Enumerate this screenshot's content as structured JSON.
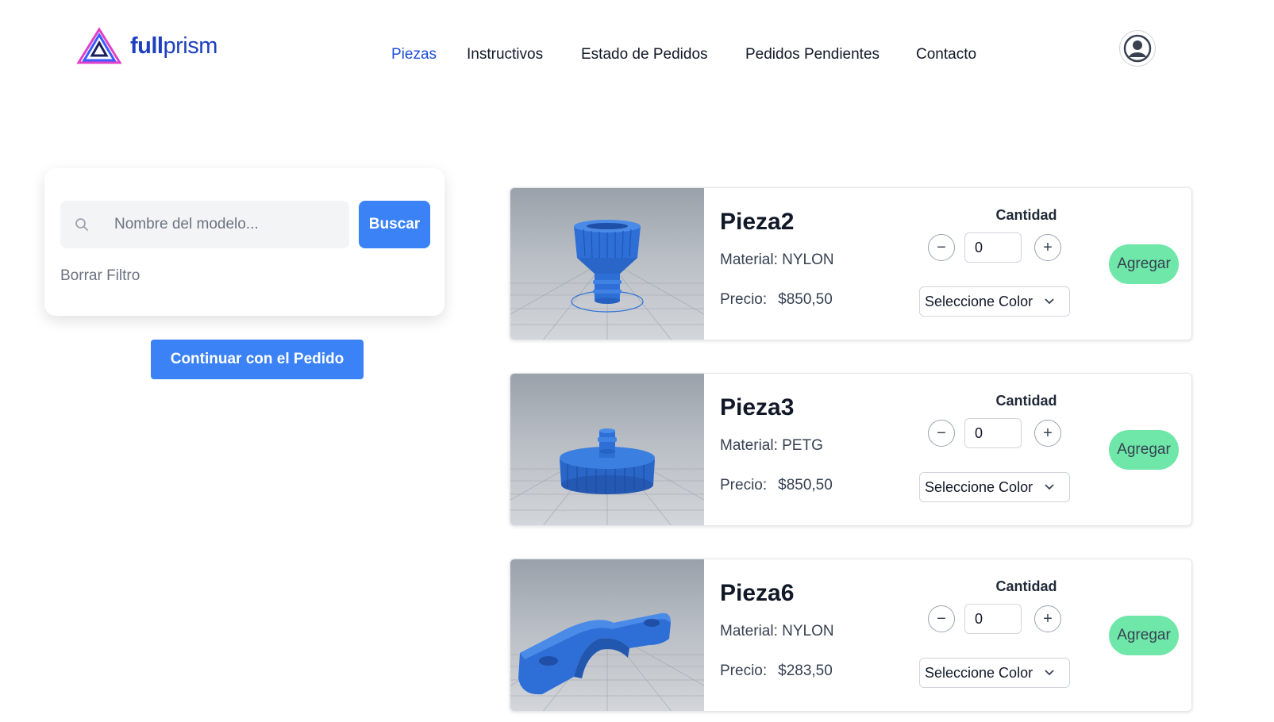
{
  "brand": {
    "name_bold": "full",
    "name_light": "prism",
    "logo_icon": "prism-triangle-icon",
    "colors": {
      "primary": "#1e3fbf",
      "accent_pink": "#e040c8",
      "accent_blue": "#3b5bff"
    }
  },
  "nav": {
    "items": [
      {
        "label": "Piezas",
        "active": true
      },
      {
        "label": "Instructivos",
        "active": false
      },
      {
        "label": "Estado de Pedidos",
        "active": false
      },
      {
        "label": "Pedidos Pendientes",
        "active": false
      },
      {
        "label": "Contacto",
        "active": false
      }
    ],
    "user_icon": "user-circle-icon"
  },
  "filter": {
    "search_placeholder": "Nombre del modelo...",
    "search_value": "",
    "search_button": "Buscar",
    "clear_label": "Borrar Filtro"
  },
  "continue_button": "Continuar con el Pedido",
  "products": [
    {
      "name": "Pieza2",
      "material": "Material: NYLON",
      "price_label": "Precio:",
      "price": "$850,50",
      "quantity_label": "Cantidad",
      "quantity": "0",
      "color_placeholder": "Seleccione Color",
      "add_label": "Agregar"
    },
    {
      "name": "Pieza3",
      "material": "Material: PETG",
      "price_label": "Precio:",
      "price": "$850,50",
      "quantity_label": "Cantidad",
      "quantity": "0",
      "color_placeholder": "Seleccione Color",
      "add_label": "Agregar"
    },
    {
      "name": "Pieza6",
      "material": "Material: NYLON",
      "price_label": "Precio:",
      "price": "$283,50",
      "quantity_label": "Cantidad",
      "quantity": "0",
      "color_placeholder": "Seleccione Color",
      "add_label": "Agregar"
    }
  ],
  "colors": {
    "button_blue": "#3b82f6",
    "add_green": "#6ee7a8",
    "part_blue": "#2d6fd6"
  }
}
